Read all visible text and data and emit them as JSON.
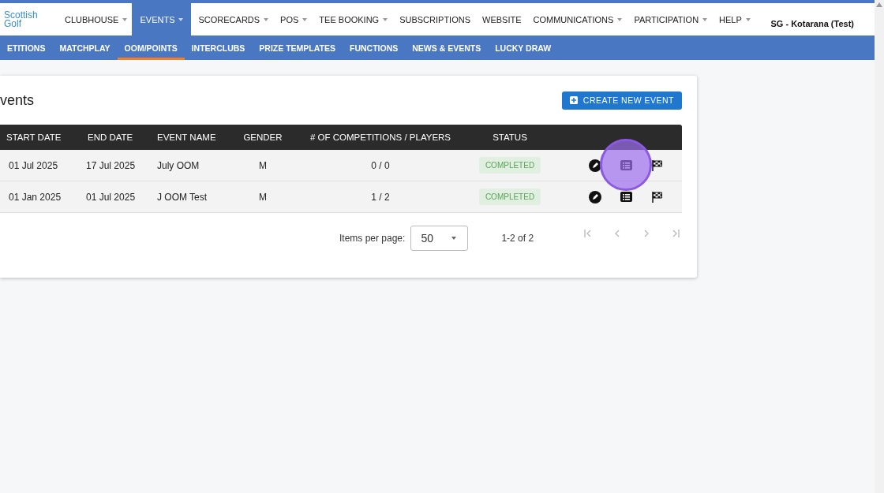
{
  "logo": {
    "line1": "Scottish",
    "line2": "Golf"
  },
  "top_nav": [
    {
      "label": "CLUBHOUSE",
      "selected": false,
      "has_caret": true
    },
    {
      "label": "EVENTS",
      "selected": true,
      "has_caret": true
    },
    {
      "label": "SCORECARDS",
      "selected": false,
      "has_caret": true
    },
    {
      "label": "POS",
      "selected": false,
      "has_caret": true
    },
    {
      "label": "TEE BOOKING",
      "selected": false,
      "has_caret": true
    },
    {
      "label": "SUBSCRIPTIONS",
      "selected": false,
      "has_caret": false
    },
    {
      "label": "WEBSITE",
      "selected": false,
      "has_caret": false
    },
    {
      "label": "COMMUNICATIONS",
      "selected": false,
      "has_caret": true
    },
    {
      "label": "PARTICIPATION",
      "selected": false,
      "has_caret": true
    },
    {
      "label": "HELP",
      "selected": false,
      "has_caret": true
    }
  ],
  "user_menu": {
    "label": "SG - Kotarana (Test)"
  },
  "sub_nav": [
    {
      "label": "ETITIONS",
      "selected": false
    },
    {
      "label": "MATCHPLAY",
      "selected": false
    },
    {
      "label": "OOM/POINTS",
      "selected": true
    },
    {
      "label": "INTERCLUBS",
      "selected": false
    },
    {
      "label": "PRIZE TEMPLATES",
      "selected": false
    },
    {
      "label": "FUNCTIONS",
      "selected": false
    },
    {
      "label": "NEWS & EVENTS",
      "selected": false
    },
    {
      "label": "LUCKY DRAW",
      "selected": false
    }
  ],
  "card": {
    "title": "vents",
    "create_button": "CREATE NEW EVENT"
  },
  "table": {
    "columns": [
      "START DATE",
      "END DATE",
      "EVENT NAME",
      "GENDER",
      "# OF COMPETITIONS / PLAYERS",
      "STATUS"
    ],
    "rows": [
      {
        "start": "01 Jul 2025",
        "end": "17 Jul 2025",
        "name": "July OOM",
        "gender": "M",
        "counts": "0 / 0",
        "status": "COMPLETED",
        "actions": [
          {
            "kind": "edit",
            "highlighted": false
          },
          {
            "kind": "list",
            "highlighted": true
          },
          {
            "kind": "flag",
            "highlighted": false
          }
        ]
      },
      {
        "start": "01 Jan 2025",
        "end": "01 Jul 2025",
        "name": "J OOM Test",
        "gender": "M",
        "counts": "1 / 2",
        "status": "COMPLETED",
        "actions": [
          {
            "kind": "edit",
            "highlighted": false
          },
          {
            "kind": "list",
            "highlighted": false
          },
          {
            "kind": "flag",
            "highlighted": false
          }
        ]
      }
    ]
  },
  "paginator": {
    "items_label": "Items per page:",
    "page_size": "50",
    "range": "1-2 of 2"
  }
}
